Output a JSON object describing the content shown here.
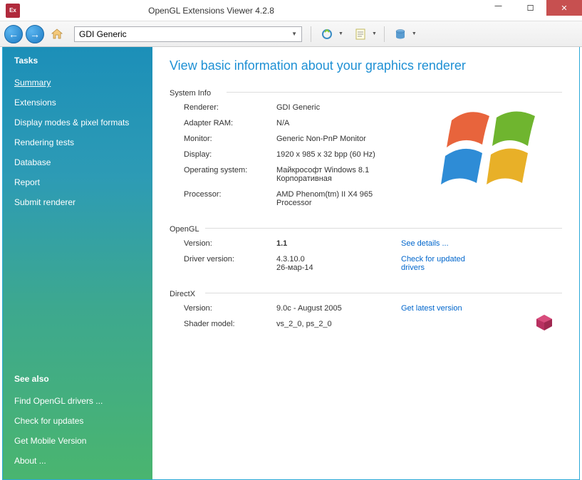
{
  "window": {
    "title": "OpenGL Extensions Viewer 4.2.8"
  },
  "toolbar": {
    "renderer_selected": "GDI Generic"
  },
  "sidebar": {
    "tasks_heading": "Tasks",
    "tasks": [
      {
        "label": "Summary",
        "active": true
      },
      {
        "label": "Extensions"
      },
      {
        "label": "Display modes & pixel formats"
      },
      {
        "label": "Rendering tests"
      },
      {
        "label": "Database"
      },
      {
        "label": "Report"
      },
      {
        "label": "Submit renderer"
      }
    ],
    "see_also_heading": "See also",
    "see_also": [
      {
        "label": "Find OpenGL drivers ..."
      },
      {
        "label": "Check for updates"
      },
      {
        "label": "Get Mobile Version"
      },
      {
        "label": "About ..."
      }
    ]
  },
  "content": {
    "title": "View basic information about your graphics renderer",
    "system_info": {
      "heading": "System Info",
      "renderer_label": "Renderer:",
      "renderer_value": "GDI Generic",
      "ram_label": "Adapter RAM:",
      "ram_value": "N/A",
      "monitor_label": "Monitor:",
      "monitor_value": "Generic Non-PnP Monitor",
      "display_label": "Display:",
      "display_value": "1920 x 985 x 32 bpp (60 Hz)",
      "os_label": "Operating system:",
      "os_value": "Майкрософт Windows 8.1 Корпоративная",
      "processor_label": "Processor:",
      "processor_value": "AMD Phenom(tm) II X4 965 Processor"
    },
    "opengl": {
      "heading": "OpenGL",
      "version_label": "Version:",
      "version_value": "1.1",
      "details_link": "See details ...",
      "driver_label": "Driver version:",
      "driver_value": "4.3.10.0\n26-мар-14",
      "update_link": "Check for updated drivers"
    },
    "directx": {
      "heading": "DirectX",
      "version_label": "Version:",
      "version_value": "9.0c - August 2005",
      "latest_link": "Get latest version",
      "shader_label": "Shader model:",
      "shader_value": "vs_2_0, ps_2_0"
    }
  }
}
